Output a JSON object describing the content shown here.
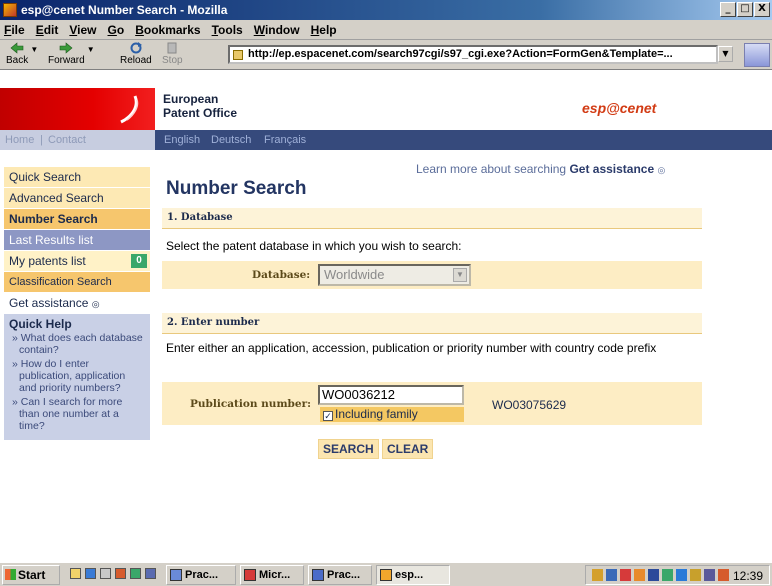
{
  "window": {
    "title": "esp@cenet Number Search - Mozilla",
    "controls": [
      "_",
      "□",
      "X"
    ]
  },
  "menu": [
    "File",
    "Edit",
    "View",
    "Go",
    "Bookmarks",
    "Tools",
    "Window",
    "Help"
  ],
  "toolbar": {
    "back": "Back",
    "forward": "Forward",
    "reload": "Reload",
    "stop": "Stop",
    "url": "http://ep.espacenet.com/search97cgi/s97_cgi.exe?Action=FormGen&Template=..."
  },
  "header": {
    "org_line1": "European",
    "org_line2": "Patent Office",
    "brand": "esp@cenet",
    "links": {
      "home": "Home",
      "contact": "Contact",
      "english": "English",
      "deutsch": "Deutsch",
      "francais": "Français"
    },
    "separator": "|"
  },
  "sidebar": {
    "items": [
      {
        "label": "Quick Search"
      },
      {
        "label": "Advanced Search"
      },
      {
        "label": "Number Search"
      },
      {
        "label": "Last Results list"
      },
      {
        "label": "My patents list",
        "badge": "0"
      },
      {
        "label": "Classification Search"
      },
      {
        "label": "Get assistance"
      }
    ],
    "quick_help": {
      "title": "Quick Help",
      "items": [
        "» What does each database contain?",
        "» How do I enter publication, application and priority numbers?",
        "» Can I search for more than one number at a time?"
      ]
    }
  },
  "main": {
    "learn_more": "Learn more about searching",
    "get_assistance": "Get assistance",
    "title": "Number Search",
    "section1": "1. Database",
    "section1_instruction": "Select the patent database in which you wish to search:",
    "database_label": "Database:",
    "database_value": "Worldwide",
    "section2": "2. Enter number",
    "section2_instruction": "Enter either an application, accession, publication or priority number with country code prefix",
    "publication_label": "Publication number:",
    "publication_value": "WO0036212",
    "including_family": "Including family",
    "example": "WO03075629",
    "search_button": "SEARCH",
    "clear_button": "CLEAR"
  },
  "taskbar": {
    "start": "Start",
    "tasks": [
      "Prac...",
      "Micr...",
      "Prac...",
      "esp..."
    ],
    "clock": "12:39"
  }
}
